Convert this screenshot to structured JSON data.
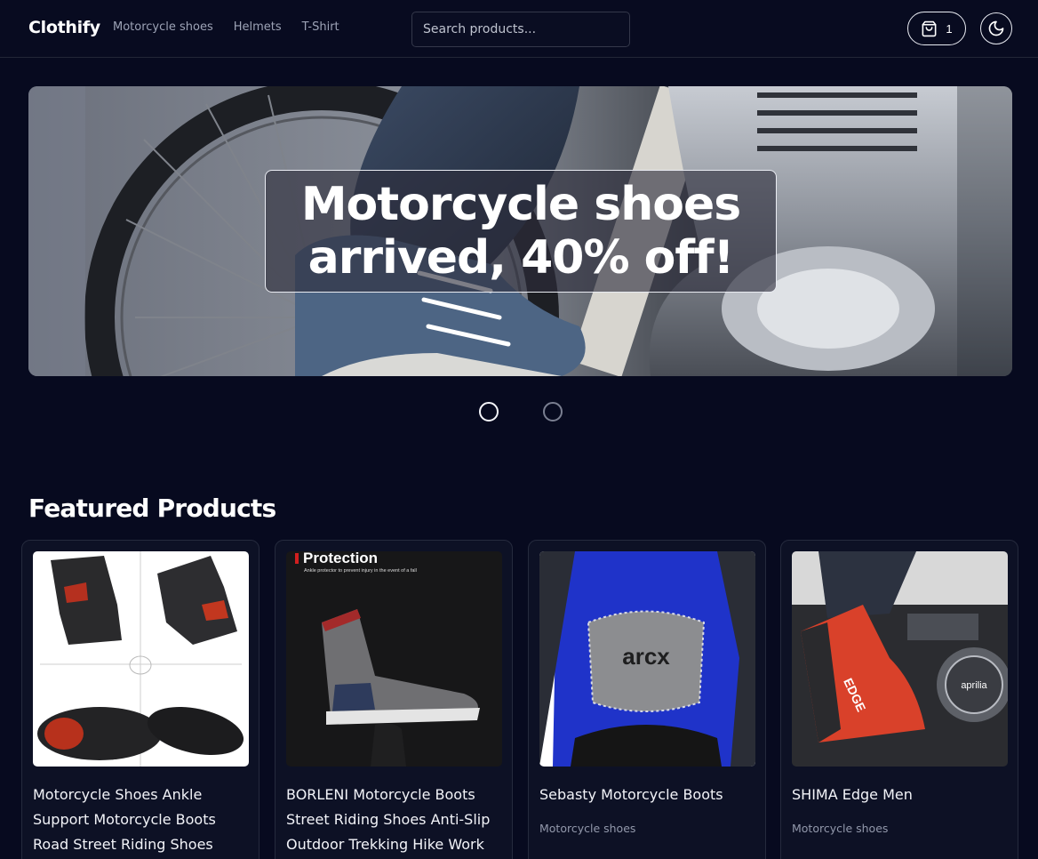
{
  "header": {
    "brand": "Clothify",
    "nav": [
      "Motorcycle shoes",
      "Helmets",
      "T-Shirt"
    ],
    "search_placeholder": "Search products...",
    "cart_count": "1"
  },
  "hero": {
    "title": "Motorcycle shoes\narrived, 40% off!",
    "slides_total": 2,
    "active_slide": 1
  },
  "products_section": {
    "title": "Featured Products",
    "items": [
      {
        "title": "Motorcycle Shoes Ankle Support Motorcycle Boots Road Street Riding Shoes",
        "category": "",
        "price": ""
      },
      {
        "title": "BORLENI Motorcycle Boots Street Riding Shoes Anti-Slip Outdoor Trekking Hike Work",
        "category": "",
        "price": "",
        "image_text": "Protection",
        "image_subtext": "Ankle protector to prevent injury in the event of a fall"
      },
      {
        "title": "Sebasty Motorcycle Boots",
        "category": "Motorcycle shoes",
        "price": "",
        "image_text": "arcx"
      },
      {
        "title": "SHIMA Edge Men",
        "category": "Motorcycle shoes",
        "price": "",
        "image_text": "aprilia"
      }
    ]
  },
  "icons": {
    "cart": "shopping-bag-icon",
    "theme": "moon-icon"
  },
  "colors": {
    "background": "#070a1f",
    "card": "#0d1125",
    "text": "#f4f5fa",
    "muted": "#9298ab"
  }
}
